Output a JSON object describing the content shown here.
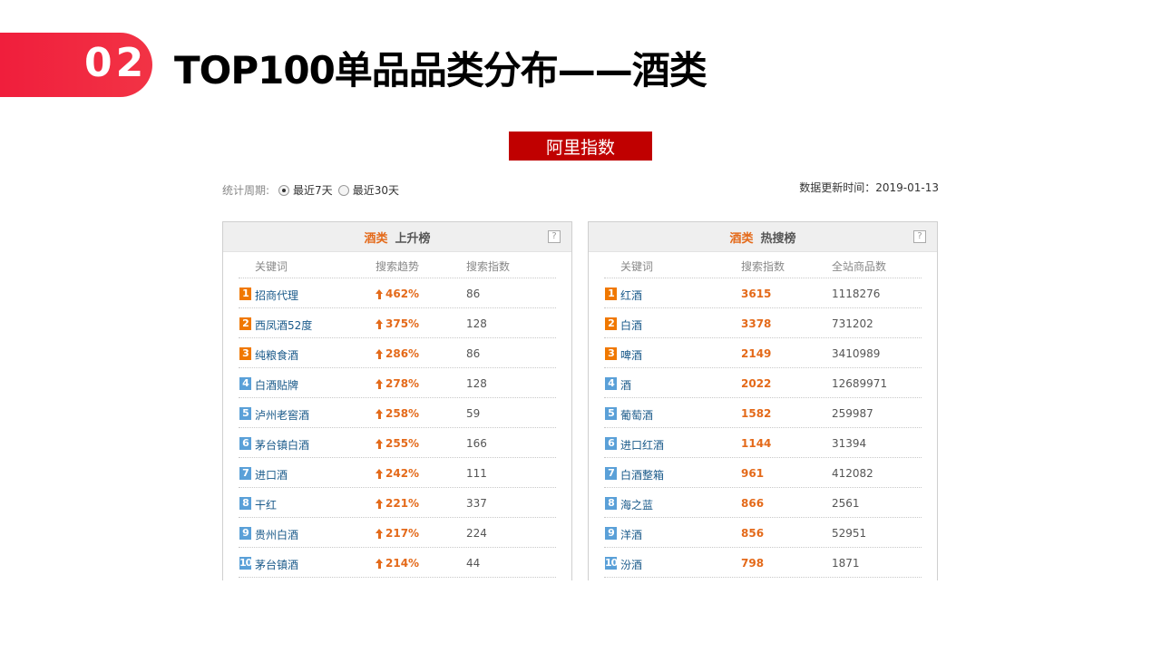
{
  "header": {
    "section_number": "02",
    "title": "TOP100单品品类分布——酒类"
  },
  "ali_index_button": "阿里指数",
  "period": {
    "label": "统计周期:",
    "options": [
      {
        "label": "最近7天",
        "selected": true
      },
      {
        "label": "最近30天",
        "selected": false
      }
    ]
  },
  "updated": "数据更新时间：2019-01-13",
  "help_symbol": "?",
  "rising": {
    "category": "酒类",
    "title": "上升榜",
    "columns": [
      "关键词",
      "搜索趋势",
      "搜索指数"
    ],
    "rows": [
      {
        "rank": "1",
        "keyword": "招商代理",
        "trend": "462%",
        "index": "86"
      },
      {
        "rank": "2",
        "keyword": "西凤酒52度",
        "trend": "375%",
        "index": "128"
      },
      {
        "rank": "3",
        "keyword": "纯粮食酒",
        "trend": "286%",
        "index": "86"
      },
      {
        "rank": "4",
        "keyword": "白酒贴牌",
        "trend": "278%",
        "index": "128"
      },
      {
        "rank": "5",
        "keyword": "泸州老窖酒",
        "trend": "258%",
        "index": "59"
      },
      {
        "rank": "6",
        "keyword": "茅台镇白酒",
        "trend": "255%",
        "index": "166"
      },
      {
        "rank": "7",
        "keyword": "进口酒",
        "trend": "242%",
        "index": "111"
      },
      {
        "rank": "8",
        "keyword": "干红",
        "trend": "221%",
        "index": "337"
      },
      {
        "rank": "9",
        "keyword": "贵州白酒",
        "trend": "217%",
        "index": "224"
      },
      {
        "rank": "10",
        "keyword": "茅台镇酒",
        "trend": "214%",
        "index": "44"
      }
    ]
  },
  "hot": {
    "category": "酒类",
    "title": "热搜榜",
    "columns": [
      "关键词",
      "搜索指数",
      "全站商品数"
    ],
    "rows": [
      {
        "rank": "1",
        "keyword": "红酒",
        "index": "3615",
        "products": "1118276"
      },
      {
        "rank": "2",
        "keyword": "白酒",
        "index": "3378",
        "products": "731202"
      },
      {
        "rank": "3",
        "keyword": "啤酒",
        "index": "2149",
        "products": "3410989"
      },
      {
        "rank": "4",
        "keyword": "酒",
        "index": "2022",
        "products": "12689971"
      },
      {
        "rank": "5",
        "keyword": "葡萄酒",
        "index": "1582",
        "products": "259987"
      },
      {
        "rank": "6",
        "keyword": "进口红酒",
        "index": "1144",
        "products": "31394"
      },
      {
        "rank": "7",
        "keyword": "白酒整箱",
        "index": "961",
        "products": "412082"
      },
      {
        "rank": "8",
        "keyword": "海之蓝",
        "index": "866",
        "products": "2561"
      },
      {
        "rank": "9",
        "keyword": "洋酒",
        "index": "856",
        "products": "52951"
      },
      {
        "rank": "10",
        "keyword": "汾酒",
        "index": "798",
        "products": "1871"
      }
    ]
  },
  "colors": {
    "accent_red": "#f01e3c",
    "button_red": "#c00000",
    "orange": "#e46a1a",
    "rank_top": "#f07800",
    "rank_normal": "#5aa0d8"
  }
}
